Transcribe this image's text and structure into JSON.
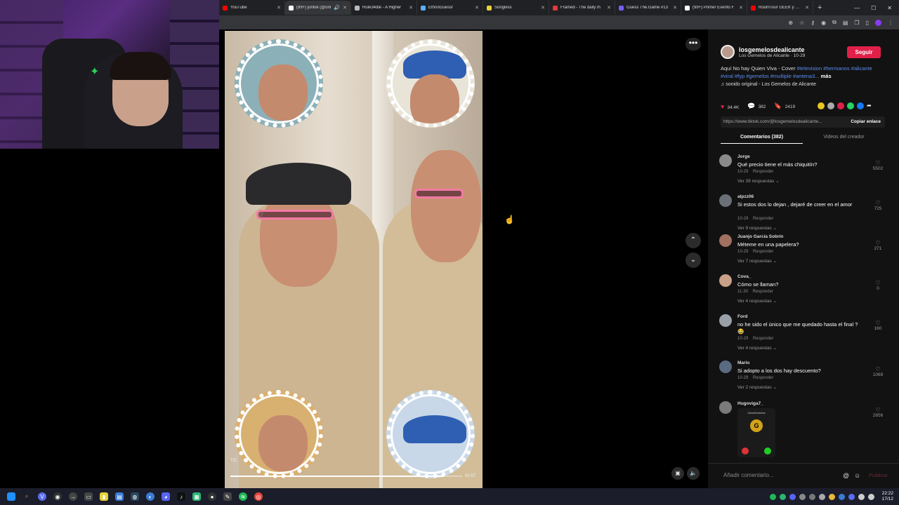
{
  "browser": {
    "tabs": [
      {
        "title": "YouTube",
        "color": "#ff0000"
      },
      {
        "title": "(99+) jonlok (@onl",
        "color": "#ffffff",
        "active": true
      },
      {
        "title": "Rule34dle - A Higher",
        "color": "#bbbbbb"
      },
      {
        "title": "EthnoGuessr",
        "color": "#5ab0ff"
      },
      {
        "title": "Songless",
        "color": "#e8d23a"
      },
      {
        "title": "Framed - The daily m",
        "color": "#e23a3a"
      },
      {
        "title": "Guess The.Game #13",
        "color": "#7a5cff"
      },
      {
        "title": "(99+) Primer Evento F",
        "color": "#ffffff"
      },
      {
        "title": "RoomTour GEEK y Exp",
        "color": "#ff0000"
      }
    ],
    "new_tab": "+",
    "window_controls": {
      "minimize": "—",
      "maximize": "☐",
      "close": "✕"
    }
  },
  "video": {
    "time": "00:57",
    "overlay_label": "TIC",
    "progress": 0.92
  },
  "post": {
    "username": "losgemelosdealicante",
    "subtitle": "Los Gemelos de Alicante · 10-29",
    "follow_label": "Seguir",
    "description_prefix": "Aquí No hay Quien Viva - Cover ",
    "description_tags": "#television #hermanos #alicante #viral #fyp #gemelos #multiple #antena3...",
    "more_label": "más",
    "sound": "♫  sonido original - Los Gemelos de Alicante",
    "likes": "34.4K",
    "comments_count": "382",
    "saves": "2419",
    "link": "https://www.tiktok.com/@losgemelosdealicante...",
    "copy_label": "Copiar enlace",
    "tab_comments": "Comentarios (382)",
    "tab_creator": "Videos del creador",
    "add_comment_placeholder": "Añadir comentario...",
    "post_label": "Publicar"
  },
  "comments": [
    {
      "user": "Jorge",
      "text": "Qué precio tiene el más chiquitín?",
      "date": "10-29",
      "reply": "Responder",
      "replies": "Ver 39 respuestas ⌄",
      "likes": "5502"
    },
    {
      "user": "alpzz06",
      "text": "Si estos dos lo dejan , dejaré de creer en el amor",
      "date": "10-29",
      "reply": "Responder",
      "replies": "Ver 9 respuestas ⌄",
      "likes": "725"
    },
    {
      "user": "Juanjo García Sobrín",
      "text": "Méteme en una papelera?",
      "date": "10-29",
      "reply": "Responder",
      "replies": "Ver 7 respuestas ⌄",
      "likes": "271"
    },
    {
      "user": "Cova_",
      "text": "Cómo se llaman?",
      "date": "11-30",
      "reply": "Responder",
      "replies": "Ver 4 respuestas ⌄",
      "likes": "0"
    },
    {
      "user": "Ford",
      "text": "no he sido el único que me quedado hasta el final ?😂",
      "date": "10-29",
      "reply": "Responder",
      "replies": "Ver 4 respuestas ⌄",
      "likes": "160"
    },
    {
      "user": "Mario",
      "text": "Si adopto a los dos hay descuento?",
      "date": "10-29",
      "reply": "Responder",
      "replies": "Ver 2 respuestas ⌄",
      "likes": "1069"
    },
    {
      "user": "Hugoviga7_",
      "text": "",
      "date": "",
      "reply": "",
      "replies": "",
      "likes": "2856"
    }
  ],
  "thumb_label": "ZonaGemelos",
  "taskbar": {
    "time": "22:22",
    "date": "17/12"
  },
  "colors": {
    "accent": "#e1204a",
    "tag": "#5b8def"
  }
}
